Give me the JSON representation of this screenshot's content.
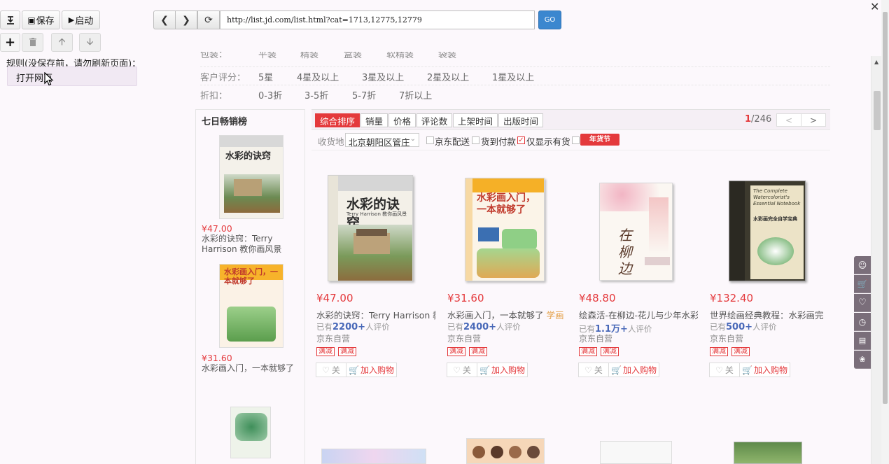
{
  "toolbar": {
    "save_label": "保存",
    "start_label": "启动",
    "rules_label": "规则(没保存前，请勿刷新页面)：",
    "open_page_label": "打开网页"
  },
  "browser": {
    "url": "http://list.jd.com/list.html?cat=1713,12775,12779",
    "go_label": "GO"
  },
  "filters": {
    "pack_row_partial": [
      "包装：",
      "平装",
      "精装",
      "盒装",
      "软精装",
      "袋装"
    ],
    "rating_label": "客户评分：",
    "rating_options": [
      "5星",
      "4星及以上",
      "3星及以上",
      "2星及以上",
      "1星及以上"
    ],
    "discount_label": "折扣：",
    "discount_options": [
      "0-3折",
      "3-5折",
      "5-7折",
      "7折以上"
    ]
  },
  "side": {
    "title": "七日畅销榜",
    "items": [
      {
        "price": "¥47.00",
        "name": "水彩的诀窍：Terry Harrison 教你画风景"
      },
      {
        "price": "¥31.60",
        "name": "水彩画入门，一本就够了"
      }
    ]
  },
  "sort": {
    "tabs": [
      "综合排序",
      "销量",
      "价格",
      "评论数",
      "上架时间",
      "出版时间"
    ],
    "page_current": "1",
    "page_total": "/246",
    "prev": "<",
    "next": ">"
  },
  "ship": {
    "label": "收货地",
    "location": "北京朝阳区管庄",
    "opt_jd": "京东配送",
    "opt_cod": "货到付款",
    "opt_stock": "仅显示有货",
    "badge": "年货节"
  },
  "products": [
    {
      "price": "¥47.00",
      "name": "水彩的诀窍：Terry Harrison 教",
      "name_ad": "",
      "comm_prefix": "已有",
      "comm_count": "2200+",
      "comm_suffix": "人评价",
      "shop": "京东自营",
      "tag1": "满减",
      "tag2": "满减",
      "follow": "关",
      "cart": "加入购物"
    },
    {
      "price": "¥31.60",
      "name": "水彩画入门，一本就够了 ",
      "name_ad": "学画",
      "comm_prefix": "已有",
      "comm_count": "2400+",
      "comm_suffix": "人评价",
      "shop": "京东自营",
      "tag1": "满减",
      "tag2": "满减",
      "follow": "关",
      "cart": "加入购物"
    },
    {
      "price": "¥48.80",
      "name": "绘森活-在柳边-花儿与少年水彩",
      "name_ad": "",
      "comm_prefix": "已有",
      "comm_count": "1.1万+",
      "comm_suffix": "人评价",
      "shop": "京东自营",
      "tag1": "满减",
      "tag2": "满减",
      "follow": "关",
      "cart": "加入购物"
    },
    {
      "price": "¥132.40",
      "name": "世界绘画经典教程：水彩画完",
      "name_ad": "",
      "comm_prefix": "已有",
      "comm_count": "500+",
      "comm_suffix": "人评价",
      "shop": "京东自营",
      "tag1": "满减",
      "tag2": "满减",
      "follow": "关",
      "cart": "加入购物"
    }
  ],
  "book_covers": {
    "b1_title": "水彩的诀窍",
    "b1_author": "Terry Harrison 教你画风景",
    "b2_title": "水彩画入门，一本就够了",
    "b4_title": "The Complete Watercolorist's Essential Notebook",
    "b4_cn": "水彩画完全自学宝典",
    "b3_title": "在柳边"
  },
  "colors": {
    "accent_red": "#e4393c",
    "go_blue": "#3b87cf"
  }
}
